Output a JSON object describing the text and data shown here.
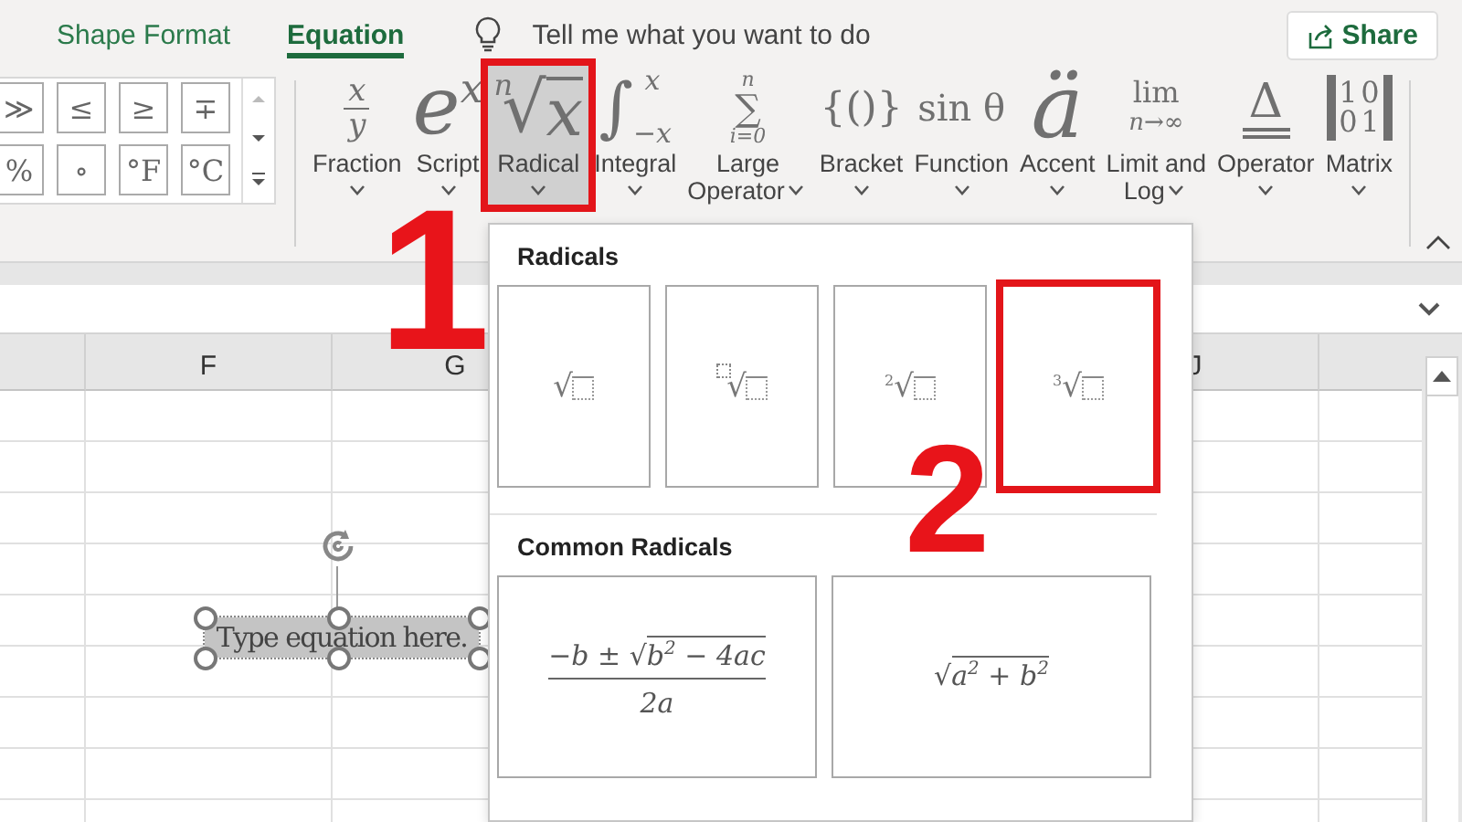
{
  "tabs": [
    {
      "label": "Shape Format",
      "selected": false
    },
    {
      "label": "Equation",
      "selected": true
    }
  ],
  "tell_me": {
    "placeholder": "Tell me what you want to do"
  },
  "share_button": {
    "label": "Share"
  },
  "symbol_gallery": [
    "≫",
    "≤",
    "≥",
    "∓",
    "%",
    "∘",
    "°F",
    "°C"
  ],
  "ribbon_buttons": [
    {
      "kind": "fraction",
      "label_lines": [
        "Fraction"
      ],
      "symbol": [
        "x",
        "y"
      ],
      "selected": false,
      "highlighted": false
    },
    {
      "kind": "script",
      "label_lines": [
        "Script"
      ],
      "symbol": [
        "e",
        "x"
      ],
      "selected": false,
      "highlighted": false
    },
    {
      "kind": "radical",
      "label_lines": [
        "Radical"
      ],
      "symbol": [
        "n",
        "√",
        "x"
      ],
      "selected": true,
      "highlighted": true
    },
    {
      "kind": "integral",
      "label_lines": [
        "Integral"
      ],
      "symbol": [
        "∫",
        "x",
        "−x"
      ],
      "selected": false,
      "highlighted": false
    },
    {
      "kind": "large_operator",
      "label_lines": [
        "Large",
        "Operator"
      ],
      "symbol": [
        "n",
        "∑",
        "i=0"
      ],
      "selected": false,
      "highlighted": false
    },
    {
      "kind": "bracket",
      "label_lines": [
        "Bracket"
      ],
      "symbol": [
        "{()}"
      ],
      "selected": false,
      "highlighted": false
    },
    {
      "kind": "function",
      "label_lines": [
        "Function"
      ],
      "symbol": [
        "sin θ"
      ],
      "selected": false,
      "highlighted": false
    },
    {
      "kind": "accent",
      "label_lines": [
        "Accent"
      ],
      "symbol": [
        "ä"
      ],
      "selected": false,
      "highlighted": false
    },
    {
      "kind": "limit",
      "label_lines": [
        "Limit and",
        "Log"
      ],
      "symbol": [
        "lim",
        "n→∞"
      ],
      "selected": false,
      "highlighted": false
    },
    {
      "kind": "operator",
      "label_lines": [
        "Operator"
      ],
      "symbol": [
        "Δ"
      ],
      "selected": false,
      "highlighted": false
    },
    {
      "kind": "matrix",
      "label_lines": [
        "Matrix"
      ],
      "symbol": [
        "1",
        "0",
        "0",
        "1"
      ],
      "selected": false,
      "highlighted": false
    }
  ],
  "columns": [
    {
      "label": "F"
    },
    {
      "label": "G"
    },
    {
      "label": "J"
    }
  ],
  "equation": {
    "text": "Type equation here."
  },
  "radicals_menu": {
    "sections": [
      {
        "title": "Radicals",
        "items": [
          {
            "kind": "radical",
            "index_placeholder": false,
            "sign": "√",
            "highlighted": false
          },
          {
            "kind": "radical",
            "index_placeholder": true,
            "sign": "√",
            "highlighted": false
          },
          {
            "kind": "radical",
            "index_placeholder": false,
            "index": "2",
            "sign": "√",
            "highlighted": false
          },
          {
            "kind": "radical",
            "index_placeholder": false,
            "index": "3",
            "sign": "√",
            "highlighted": true
          }
        ]
      },
      {
        "title": "Common Radicals",
        "items": [
          {
            "kind": "formula_fraction",
            "prefix": "−b ±",
            "sign": "√",
            "radicand": "b$^{2}$ − 4ac",
            "denominator": "2a",
            "highlighted": false
          },
          {
            "kind": "formula_root",
            "sign": "√",
            "radicand": "a$^{2}$ + b$^{2}$",
            "highlighted": false
          }
        ]
      }
    ]
  },
  "annotations": [
    {
      "label": "1"
    },
    {
      "label": "2"
    }
  ]
}
